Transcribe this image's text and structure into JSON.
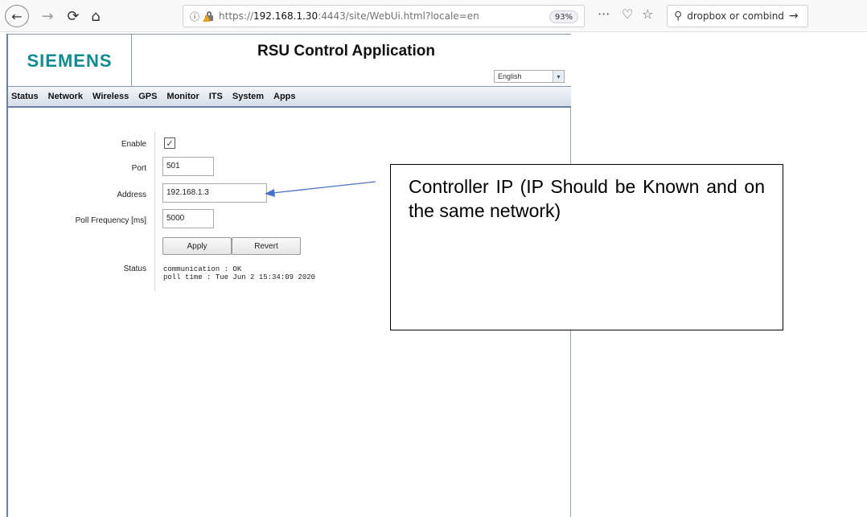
{
  "browser": {
    "back_glyph": "←",
    "forward_glyph": "→",
    "reload_glyph": "⟳",
    "home_glyph": "⌂",
    "url_info_glyph": "ⓘ",
    "url_prefix": "https://",
    "url_host": "192.168.1.30",
    "url_rest": ":4443/site/WebUi.html?locale=en",
    "zoom": "93%",
    "menu_glyph": "···",
    "pocket_glyph": "♡",
    "bookmark_glyph": "☆",
    "search_glyph": "⚲",
    "search_text": "dropbox or combind",
    "search_go_glyph": "→"
  },
  "app": {
    "logo": "SIEMENS",
    "title": "RSU Control Application",
    "language": {
      "selected": "English",
      "arrow": "▾"
    },
    "menu": [
      "Status",
      "Network",
      "Wireless",
      "GPS",
      "Monitor",
      "ITS",
      "System",
      "Apps"
    ]
  },
  "form": {
    "enable_label": "Enable",
    "enable_checked": true,
    "check_glyph": "✓",
    "port_label": "Port",
    "port_value": "501",
    "address_label": "Address",
    "address_value": "192.168.1.3",
    "poll_label": "Poll Frequency [ms]",
    "poll_value": "5000",
    "apply_label": "Apply",
    "revert_label": "Revert",
    "status_label": "Status",
    "status_lines": "communication : OK\npoll time : Tue Jun 2 15:34:09 2020"
  },
  "annotation": {
    "text": "Controller IP (IP Should be Known and on the same network)"
  },
  "colors": {
    "brand": "#0f8a8f",
    "menu_border": "#6b7f9f",
    "arrow": "#4a72c4"
  }
}
